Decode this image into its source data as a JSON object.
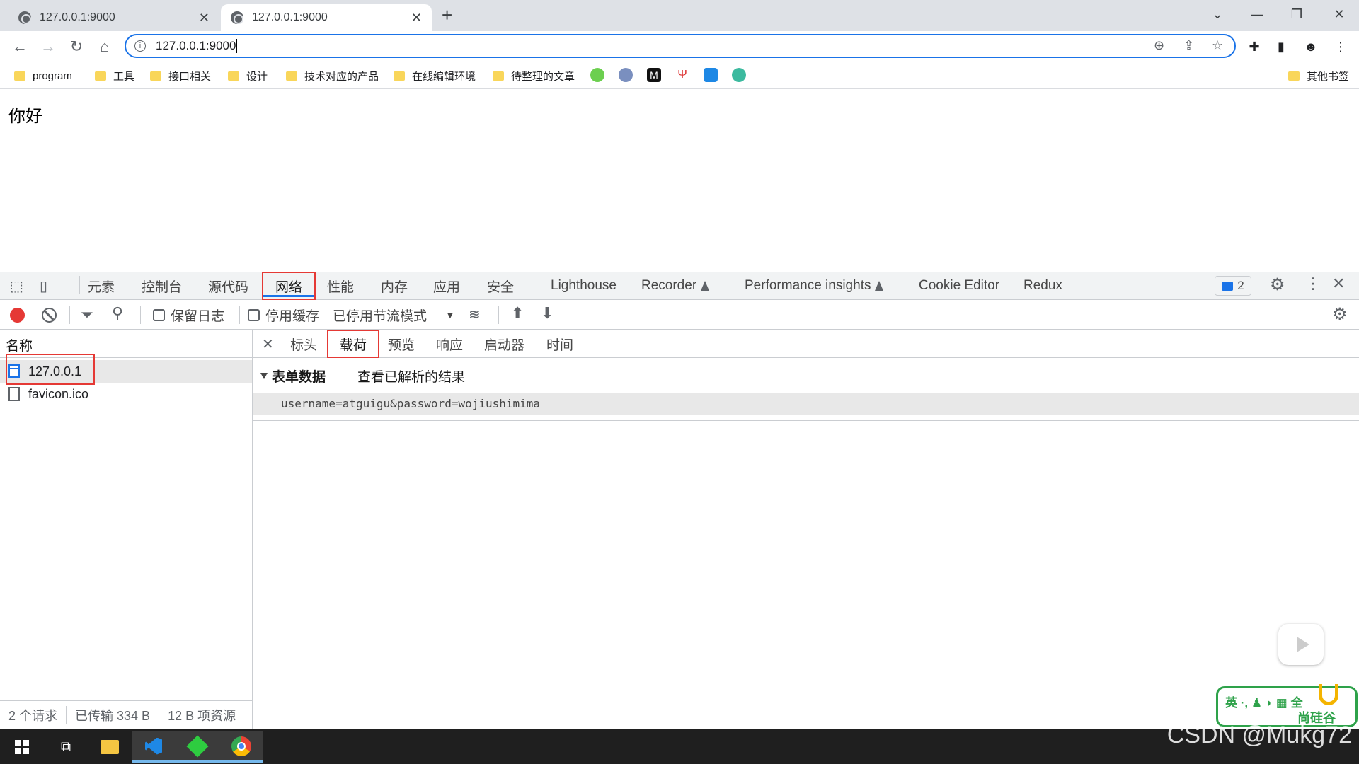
{
  "browser": {
    "tabs": [
      {
        "title": "127.0.0.1:9000",
        "active": false
      },
      {
        "title": "127.0.0.1:9000",
        "active": true
      }
    ],
    "new_tab": "+",
    "url": "127.0.0.1:9000",
    "bookmarks": [
      {
        "label": "program"
      },
      {
        "label": "工具"
      },
      {
        "label": "接口相关"
      },
      {
        "label": "设计"
      },
      {
        "label": "技术对应的产品"
      },
      {
        "label": "在线编辑环境"
      },
      {
        "label": "待整理的文章"
      }
    ],
    "other_bookmarks": "其他书签"
  },
  "page": {
    "text": "你好"
  },
  "devtools": {
    "tabs": [
      "元素",
      "控制台",
      "源代码",
      "网络",
      "性能",
      "内存",
      "应用",
      "安全",
      "Lighthouse",
      "Recorder",
      "Performance insights",
      "Cookie Editor",
      "Redux"
    ],
    "selected_tab": "网络",
    "issues_count": "2",
    "toolbar": {
      "preserve_log": "保留日志",
      "disable_cache": "停用缓存",
      "throttle": "已停用节流模式"
    },
    "name_header": "名称",
    "requests": [
      {
        "name": "127.0.0.1",
        "selected": true
      },
      {
        "name": "favicon.ico",
        "selected": false
      }
    ],
    "footer": {
      "requests": "2 个请求",
      "transferred": "已传输 334 B",
      "resources": "12 B 项资源"
    },
    "detail_tabs": [
      "标头",
      "载荷",
      "预览",
      "响应",
      "启动器",
      "时间"
    ],
    "selected_detail_tab": "载荷",
    "form_section_title": "表单数据",
    "view_parsed": "查看已解析的结果",
    "form_data": "username=atguigu&password=wojiushimima"
  },
  "overlay": {
    "badge_line1": "英 ·, ♟ ◗ ▦ 全",
    "badge_brand": "尚硅谷",
    "watermark": "CSDN @Mukg72"
  },
  "colors": {
    "accent": "#1a73e8",
    "highlight": "#e53935",
    "record": "#e53935"
  }
}
